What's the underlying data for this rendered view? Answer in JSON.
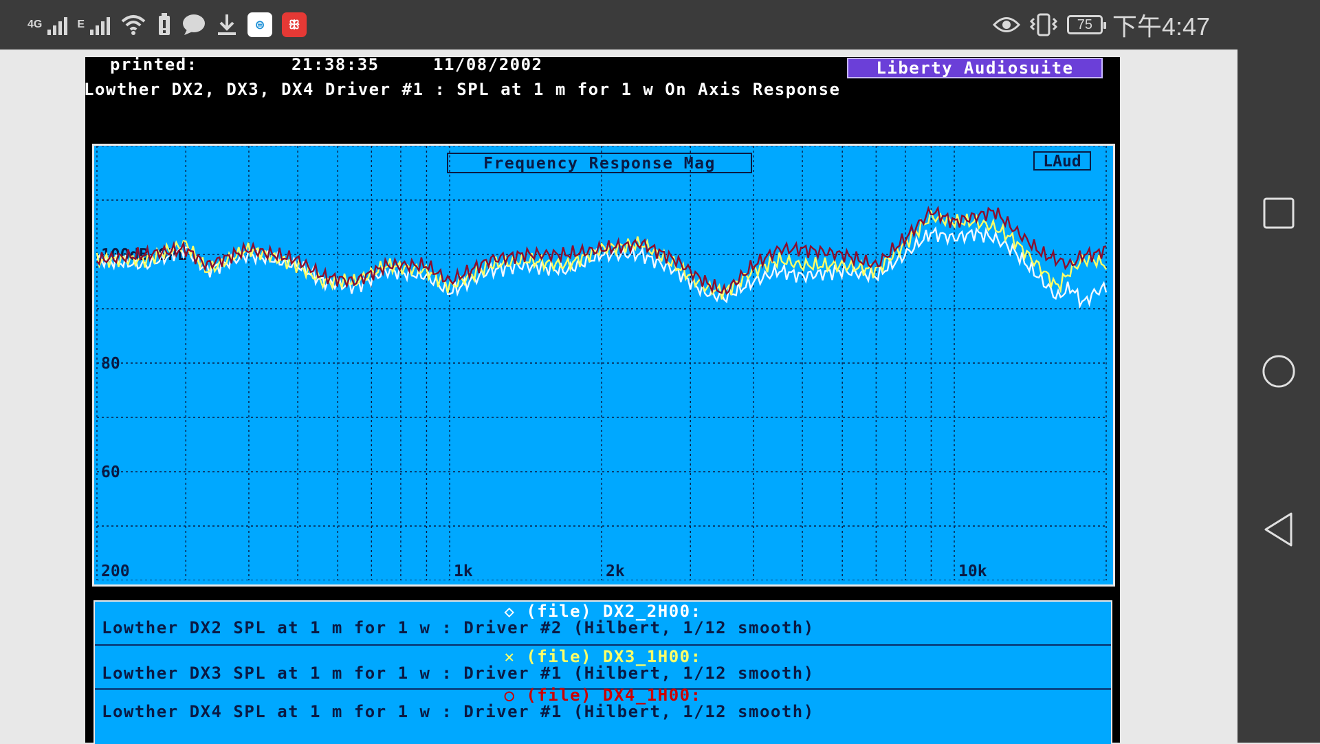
{
  "status_bar": {
    "network_type": "4G",
    "network_type_2": "E",
    "battery": "75",
    "time": "下午4:47",
    "app_badge_1": "⊜",
    "app_badge_2": "ꕥ"
  },
  "printout": {
    "printed_label": "printed:",
    "printed_time": "21:38:35",
    "printed_date": "11/08/2002",
    "brand": "Liberty Audiosuite",
    "heading": "Lowther DX2, DX3, DX4 Driver #1 : SPL at 1 m for 1 w On Axis Response"
  },
  "legend": [
    {
      "marker": "◇",
      "title": "(file) DX2_2H00:",
      "desc": "Lowther DX2 SPL at 1 m for 1 w : Driver #2 (Hilbert, 1/12 smooth)",
      "color": "#ffffff"
    },
    {
      "marker": "✕",
      "title": "(file) DX3_1H00:",
      "desc": "Lowther DX3 SPL at 1 m for 1 w : Driver #1 (Hilbert, 1/12 smooth)",
      "color": "#ffff66"
    },
    {
      "marker": "○",
      "title": "(file) DX4_1H00:",
      "desc": "Lowther DX4 SPL at 1 m for 1 w : Driver #1 (Hilbert, 1/12 smooth)",
      "color": "#cc0000"
    }
  ],
  "chart_data": {
    "type": "line",
    "title": "Frequency Response Mag",
    "corner_label": "LAud",
    "xscale": "log",
    "xlim": [
      200,
      20000
    ],
    "ylim": [
      40,
      120
    ],
    "y_ref_label": "100dB SPL",
    "y_ticks": [
      {
        "value": 100,
        "label": "100dB SPL"
      },
      {
        "value": 80,
        "label": "80"
      },
      {
        "value": 60,
        "label": "60"
      }
    ],
    "x_ticks": [
      {
        "value": 200,
        "label": "200"
      },
      {
        "value": 1000,
        "label": "1k"
      },
      {
        "value": 2000,
        "label": "2k"
      },
      {
        "value": 10000,
        "label": "10k"
      }
    ],
    "grid": true,
    "background": "#00a8ff",
    "series": [
      {
        "name": "DX2_2H00",
        "color": "#f4f8ff",
        "points": [
          [
            200,
            99
          ],
          [
            250,
            98
          ],
          [
            300,
            101
          ],
          [
            330,
            97
          ],
          [
            400,
            100
          ],
          [
            500,
            98
          ],
          [
            560,
            95
          ],
          [
            650,
            94
          ],
          [
            750,
            97
          ],
          [
            900,
            96
          ],
          [
            1000,
            93
          ],
          [
            1200,
            97
          ],
          [
            1400,
            98
          ],
          [
            1700,
            97
          ],
          [
            2000,
            100
          ],
          [
            2400,
            100
          ],
          [
            2800,
            97
          ],
          [
            3200,
            93
          ],
          [
            3500,
            92
          ],
          [
            4000,
            95
          ],
          [
            4500,
            97
          ],
          [
            5000,
            96
          ],
          [
            6000,
            97
          ],
          [
            7000,
            96
          ],
          [
            8000,
            100
          ],
          [
            9000,
            104
          ],
          [
            10000,
            103
          ],
          [
            11000,
            104
          ],
          [
            12000,
            103
          ],
          [
            13000,
            101
          ],
          [
            15000,
            95
          ],
          [
            16000,
            92
          ],
          [
            17000,
            94
          ],
          [
            18000,
            91
          ],
          [
            19000,
            93
          ],
          [
            20000,
            94
          ]
        ]
      },
      {
        "name": "DX3_1H00",
        "color": "#ffff66",
        "points": [
          [
            200,
            99
          ],
          [
            250,
            99
          ],
          [
            300,
            102
          ],
          [
            330,
            97
          ],
          [
            400,
            101
          ],
          [
            500,
            98
          ],
          [
            560,
            95
          ],
          [
            650,
            95
          ],
          [
            750,
            98
          ],
          [
            900,
            97
          ],
          [
            1000,
            94
          ],
          [
            1200,
            98
          ],
          [
            1400,
            99
          ],
          [
            1700,
            98
          ],
          [
            2000,
            101
          ],
          [
            2400,
            102
          ],
          [
            2800,
            98
          ],
          [
            3200,
            94
          ],
          [
            3500,
            93
          ],
          [
            4000,
            97
          ],
          [
            4500,
            99
          ],
          [
            5000,
            98
          ],
          [
            6000,
            98
          ],
          [
            7000,
            97
          ],
          [
            8000,
            102
          ],
          [
            9000,
            107
          ],
          [
            10000,
            106
          ],
          [
            11000,
            106
          ],
          [
            12000,
            105
          ],
          [
            13000,
            103
          ],
          [
            15000,
            97
          ],
          [
            16000,
            94
          ],
          [
            17000,
            97
          ],
          [
            18000,
            99
          ],
          [
            19000,
            99
          ],
          [
            20000,
            98
          ]
        ]
      },
      {
        "name": "DX4_1H00",
        "color": "#8a0e2e",
        "points": [
          [
            200,
            99
          ],
          [
            250,
            100
          ],
          [
            300,
            101
          ],
          [
            330,
            98
          ],
          [
            400,
            101
          ],
          [
            500,
            99
          ],
          [
            560,
            96
          ],
          [
            650,
            95
          ],
          [
            750,
            98
          ],
          [
            900,
            98
          ],
          [
            1000,
            95
          ],
          [
            1200,
            99
          ],
          [
            1400,
            100
          ],
          [
            1700,
            100
          ],
          [
            2000,
            101
          ],
          [
            2400,
            102
          ],
          [
            2800,
            99
          ],
          [
            3200,
            95
          ],
          [
            3500,
            93
          ],
          [
            4000,
            98
          ],
          [
            4500,
            101
          ],
          [
            5000,
            101
          ],
          [
            6000,
            100
          ],
          [
            7000,
            98
          ],
          [
            8000,
            103
          ],
          [
            9000,
            108
          ],
          [
            10000,
            106
          ],
          [
            11000,
            107
          ],
          [
            12000,
            108
          ],
          [
            13000,
            105
          ],
          [
            15000,
            100
          ],
          [
            16000,
            99
          ],
          [
            17000,
            98
          ],
          [
            18000,
            100
          ],
          [
            19000,
            100
          ],
          [
            20000,
            101
          ]
        ]
      }
    ]
  }
}
